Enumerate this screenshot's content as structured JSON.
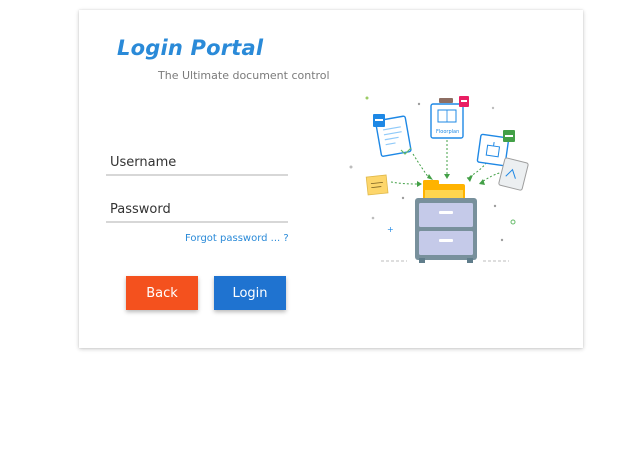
{
  "header": {
    "title": "Login Portal",
    "subtitle": "The Ultimate document control"
  },
  "form": {
    "username_placeholder": "Username",
    "username_value": "",
    "password_placeholder": "Password",
    "password_value": "",
    "forgot_label": "Forgot password ... ?"
  },
  "buttons": {
    "back_label": "Back",
    "login_label": "Login"
  },
  "colors": {
    "title": "#2a8ad8",
    "back_button": "#f4511e",
    "login_button": "#1f73d0",
    "link": "#2a8ad8"
  },
  "illustration": {
    "name": "file-cabinet-illustration",
    "doc_label": "Floorplan"
  }
}
